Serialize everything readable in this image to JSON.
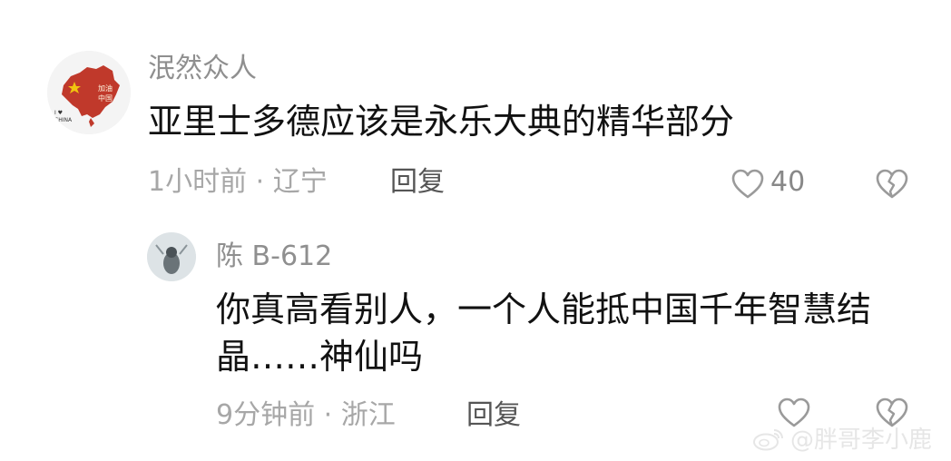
{
  "comments": [
    {
      "username": "泯然众人",
      "text": "亚里士多德应该是永乐大典的精华部分",
      "meta": "1小时前 · 辽宁",
      "reply_label": "回复",
      "likes": "40",
      "avatar": {
        "badge_text": "加油中国",
        "small_text": "I ♥ CHINA",
        "colors": {
          "map": "#c0392b",
          "star": "#f1c40f"
        }
      }
    },
    {
      "username": "陈 B-612",
      "text": "你真高看别人，一个人能抵中国千年智慧结晶……神仙吗",
      "meta": "9分钟前 · 浙江",
      "reply_label": "回复"
    }
  ],
  "watermark": {
    "text": "@胖哥李小鹿"
  },
  "colors": {
    "meta_text": "#a7a7a7",
    "reply_text": "#555555",
    "body_text": "#111111"
  },
  "icons": {
    "like": "heart-outline-icon",
    "dislike": "broken-heart-icon",
    "weibo": "weibo-logo-icon"
  }
}
